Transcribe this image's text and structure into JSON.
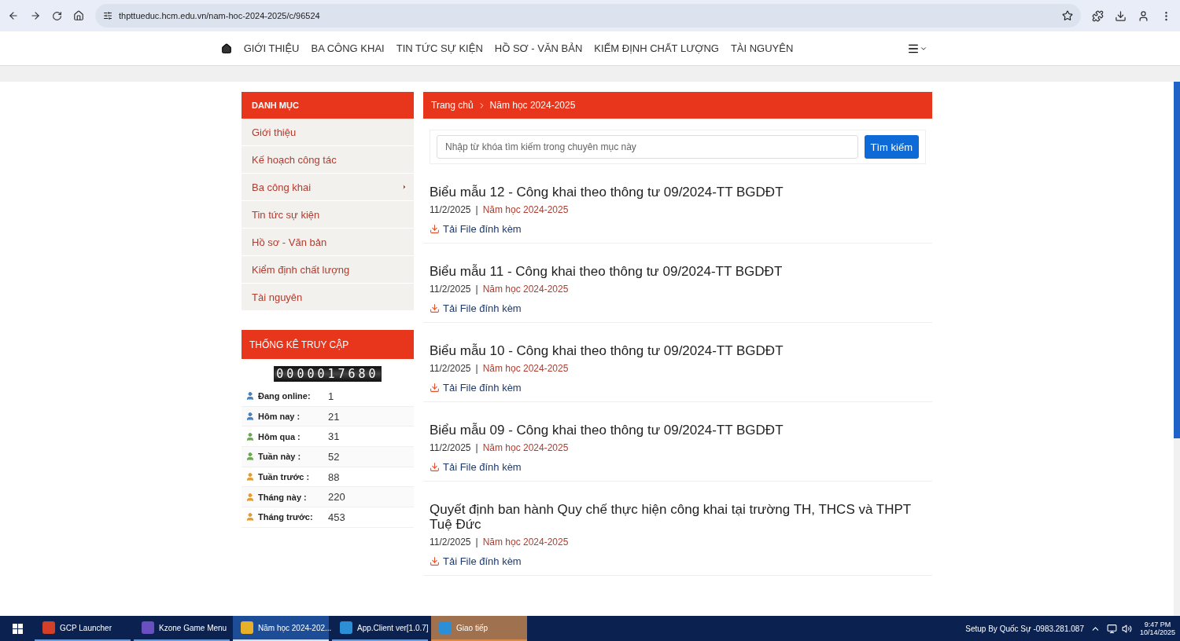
{
  "browser": {
    "url": "thpttueduc.hcm.edu.vn/nam-hoc-2024-2025/c/96524"
  },
  "nav": {
    "items": [
      "GIỚI THIỆU",
      "BA CÔNG KHAI",
      "TIN TỨC SỰ KIỆN",
      "HỒ SƠ - VĂN BẢN",
      "KIỂM ĐỊNH CHẤT LƯỢNG",
      "TÀI NGUYÊN"
    ]
  },
  "sidebar": {
    "title": "DANH MỤC",
    "items": [
      {
        "label": "Giới thiệu",
        "has_submenu": false
      },
      {
        "label": "Kế hoạch công tác",
        "has_submenu": false
      },
      {
        "label": "Ba công khai",
        "has_submenu": true
      },
      {
        "label": "Tin tức sự kiện",
        "has_submenu": false
      },
      {
        "label": "Hồ sơ - Văn bản",
        "has_submenu": false
      },
      {
        "label": "Kiểm định chất lượng",
        "has_submenu": false
      },
      {
        "label": "Tài nguyên",
        "has_submenu": false
      }
    ]
  },
  "stats": {
    "title": "THỐNG KÊ TRUY CẬP",
    "counter": "0000017680",
    "rows": [
      {
        "label": "Đang online:",
        "value": "1",
        "color": "#4a7fc1"
      },
      {
        "label": "Hôm nay :",
        "value": "21",
        "color": "#4a7fc1"
      },
      {
        "label": "Hôm qua :",
        "value": "31",
        "color": "#6aa84f"
      },
      {
        "label": "Tuần này :",
        "value": "52",
        "color": "#6aa84f"
      },
      {
        "label": "Tuần trước :",
        "value": "88",
        "color": "#e69b2e"
      },
      {
        "label": "Tháng này :",
        "value": "220",
        "color": "#e69b2e"
      },
      {
        "label": "Tháng trước:",
        "value": "453",
        "color": "#e69b2e"
      }
    ]
  },
  "breadcrumb": [
    "Trang chủ",
    "Năm học 2024-2025"
  ],
  "search": {
    "placeholder": "Nhập từ khóa tìm kiếm trong chuyên mục này",
    "button": "Tìm kiếm"
  },
  "articles": [
    {
      "title": "Biểu mẫu 12 - Công khai theo thông tư 09/2024-TT BGDĐT",
      "date": "11/2/2025",
      "separator": "|",
      "category": "Năm học 2024-2025",
      "attachment": "Tải File đính kèm"
    },
    {
      "title": "Biểu mẫu 11 - Công khai theo thông tư 09/2024-TT BGDĐT",
      "date": "11/2/2025",
      "separator": "|",
      "category": "Năm học 2024-2025",
      "attachment": "Tải File đính kèm"
    },
    {
      "title": "Biểu mẫu 10 - Công khai theo thông tư 09/2024-TT BGDĐT",
      "date": "11/2/2025",
      "separator": "|",
      "category": "Năm học 2024-2025",
      "attachment": "Tải File đính kèm"
    },
    {
      "title": "Biểu mẫu 09 - Công khai theo thông tư 09/2024-TT BGDĐT",
      "date": "11/2/2025",
      "separator": "|",
      "category": "Năm học 2024-2025",
      "attachment": "Tải File đính kèm"
    },
    {
      "title": "Quyết định ban hành Quy chế thực hiện công khai tại trường TH, THCS và THPT Tuệ Đức",
      "date": "11/2/2025",
      "separator": "|",
      "category": "Năm học 2024-2025",
      "attachment": "Tải File đính kèm"
    }
  ],
  "taskbar": {
    "apps": [
      {
        "label": "GCP Launcher",
        "selected": false,
        "attention": false
      },
      {
        "label": "Kzone Game Menu",
        "selected": false,
        "attention": false
      },
      {
        "label": "Năm học 2024-202...",
        "selected": true,
        "attention": false
      },
      {
        "label": "App.Client ver[1.0.7]",
        "selected": false,
        "attention": false
      },
      {
        "label": "Giao tiếp",
        "selected": false,
        "attention": true
      }
    ],
    "tray_text": "Setup By Quốc Sự -0983.281.087",
    "time": "9:47 PM",
    "date": "10/14/2025"
  }
}
